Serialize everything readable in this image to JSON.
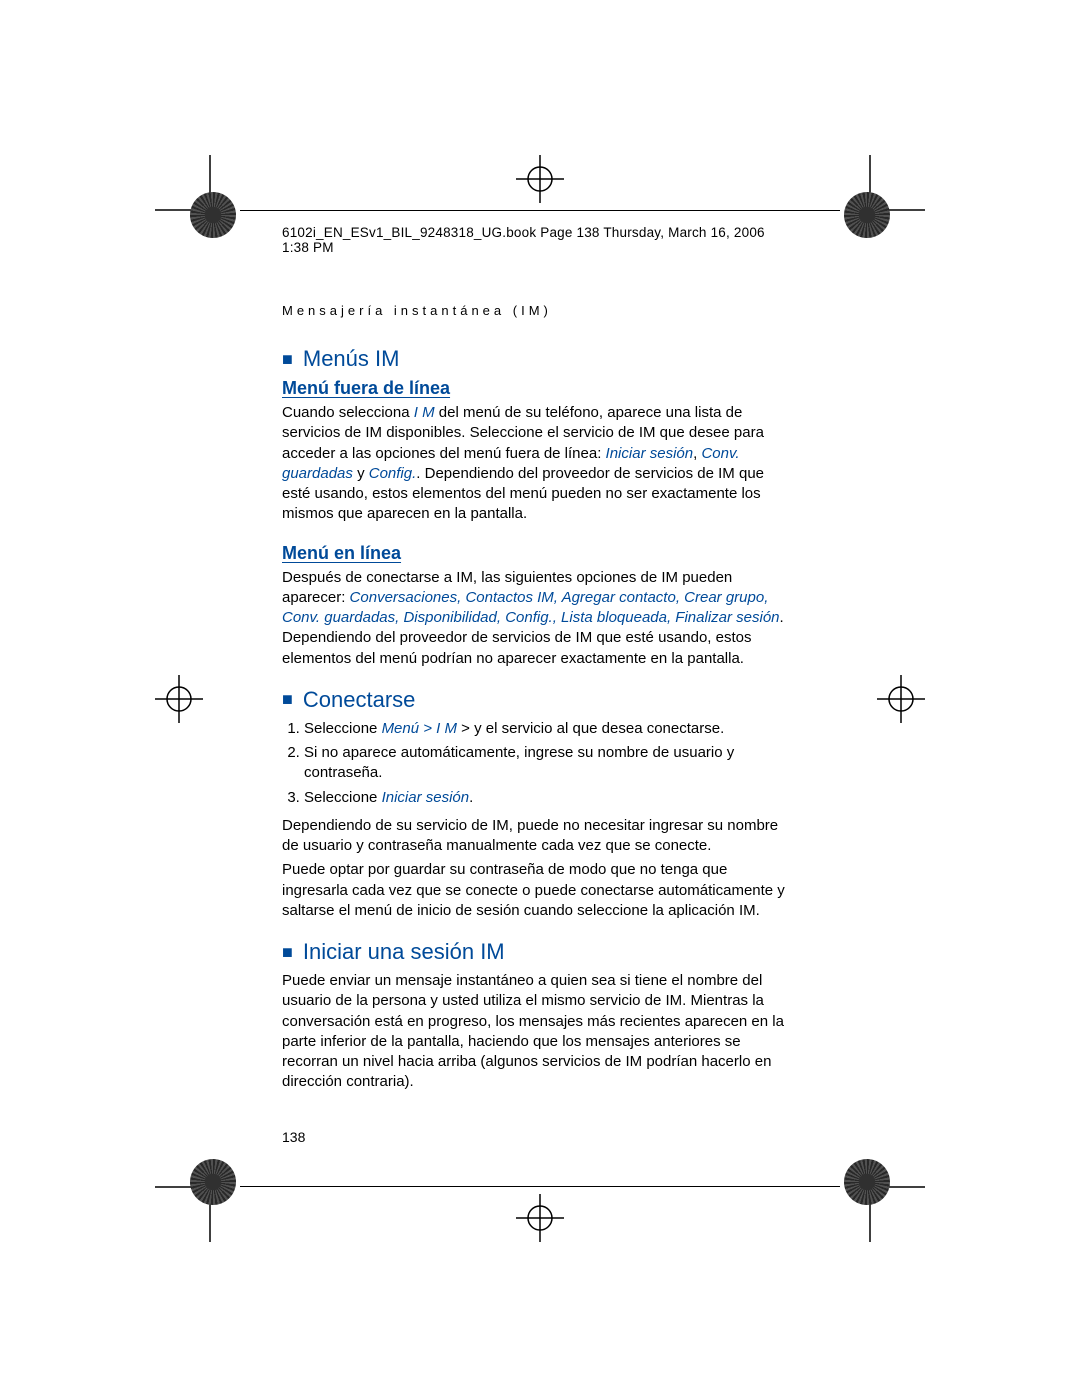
{
  "fileHeader": "6102i_EN_ESv1_BIL_9248318_UG.book  Page 138  Thursday, March 16, 2006  1:38 PM",
  "sectionHeader": "Mensajería instantánea (IM)",
  "sections": {
    "menusIM": {
      "title": "Menús IM",
      "offline": {
        "title": "Menú fuera de línea",
        "p1_a": "Cuando selecciona ",
        "p1_accent1": "I M",
        "p1_b": " del menú de su teléfono, aparece una lista de servicios de IM disponibles. Seleccione el servicio de IM que desee para acceder a las opciones del menú fuera de línea: ",
        "p1_accent2": "Iniciar sesión",
        "p1_c": ", ",
        "p1_accent3": "Conv. guardadas",
        "p1_d": " y ",
        "p1_accent4": "Config.",
        "p1_e": ". Dependiendo del proveedor de servicios de IM que esté usando, estos elementos del menú pueden no ser exactamente los mismos que aparecen en la pantalla."
      },
      "online": {
        "title": "Menú en línea",
        "p1": "Después de conectarse a IM, las siguientes opciones de IM pueden aparecer: ",
        "p1_accentList": "Conversaciones, Contactos IM, Agregar contacto, Crear grupo, Conv. guardadas, Disponibilidad, Config., Lista bloqueada, Finalizar sesión",
        "p1_b": ". Dependiendo del proveedor de servicios de IM que esté usando, estos elementos del menú podrían no aparecer exactamente en la pantalla."
      }
    },
    "conectarse": {
      "title": "Conectarse",
      "steps": {
        "s1_a": "Seleccione ",
        "s1_accent": "Menú > I M",
        "s1_b": " > y el servicio al que desea conectarse.",
        "s2": "Si no aparece automáticamente, ingrese su nombre de usuario y contraseña.",
        "s3_a": "Seleccione ",
        "s3_accent": "Iniciar sesión",
        "s3_b": "."
      },
      "p1": "Dependiendo de su servicio de IM, puede no necesitar ingresar su nombre de usuario y contraseña manualmente cada vez que se conecte.",
      "p2": "Puede optar por guardar su contraseña de modo que no tenga que ingresarla cada vez que se conecte o puede conectarse automáticamente y saltarse el menú de inicio de sesión cuando seleccione la aplicación IM."
    },
    "iniciarSesion": {
      "title": "Iniciar una sesión IM",
      "p1": "Puede enviar un mensaje instantáneo a quien sea si tiene el nombre del usuario de la persona y usted utiliza el mismo servicio de IM. Mientras la conversación está en progreso, los mensajes más recientes aparecen en la parte inferior de la pantalla, haciendo que los mensajes anteriores se recorran un nivel hacia arriba (algunos servicios de IM podrían hacerlo en dirección contraria)."
    }
  },
  "pageNumber": "138"
}
